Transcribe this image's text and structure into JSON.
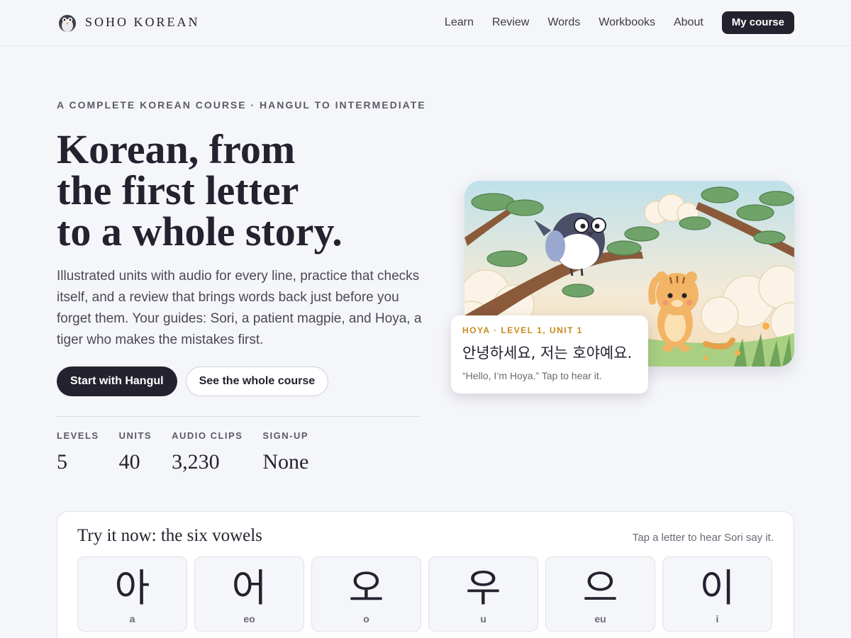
{
  "header": {
    "brand": "SOHO KOREAN",
    "logo_icon": "penguin-logo-icon",
    "nav": [
      "Learn",
      "Review",
      "Words",
      "Workbooks",
      "About"
    ],
    "cta": "My course"
  },
  "hero": {
    "eyebrow": "A COMPLETE KOREAN COURSE · HANGUL TO INTERMEDIATE",
    "title_lines": [
      "Korean, from",
      "the first letter",
      "to a whole story."
    ],
    "description": "Illustrated units with audio for every line, practice that checks itself, and a review that brings words back just before you forget them. Your guides: Sori, a patient magpie, and Hoya, a tiger who makes the mistakes first.",
    "primary_button": "Start with Hangul",
    "secondary_button": "See the whole course",
    "stats": [
      {
        "label": "LEVELS",
        "value": "5"
      },
      {
        "label": "UNITS",
        "value": "40"
      },
      {
        "label": "AUDIO CLIPS",
        "value": "3,230"
      },
      {
        "label": "SIGN-UP",
        "value": "None"
      }
    ]
  },
  "speech_card": {
    "eyebrow": "HOYA · LEVEL 1, UNIT 1",
    "korean": "안녕하세요, 저는 호야예요.",
    "translation": "“Hello, I’m Hoya.” Tap to hear it."
  },
  "vowels": {
    "title": "Try it now: the six vowels",
    "hint": "Tap a letter to hear Sori say it.",
    "items": [
      {
        "char": "아",
        "roman": "a"
      },
      {
        "char": "어",
        "roman": "eo"
      },
      {
        "char": "오",
        "roman": "o"
      },
      {
        "char": "우",
        "roman": "u"
      },
      {
        "char": "으",
        "roman": "eu"
      },
      {
        "char": "이",
        "roman": "i"
      }
    ]
  },
  "colors": {
    "ink": "#24222e",
    "background": "#f5f6fa",
    "accent": "#c88a1c"
  }
}
